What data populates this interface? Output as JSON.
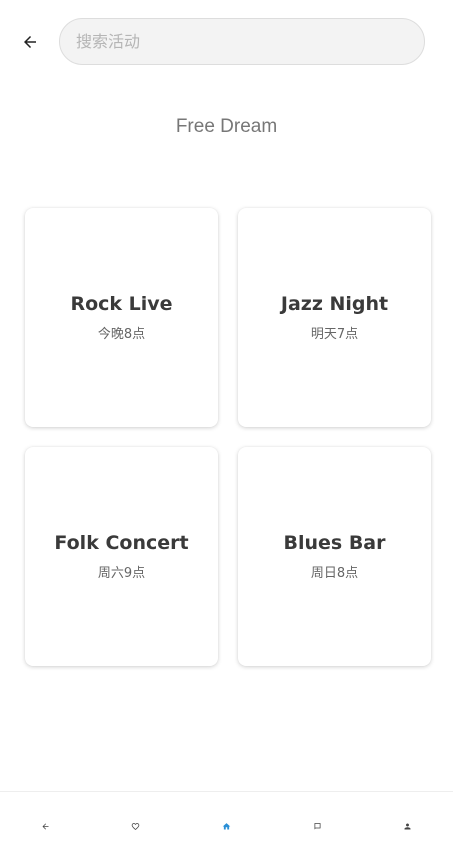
{
  "header": {
    "back_icon": "arrow-left-icon",
    "search": {
      "placeholder": "搜索活动",
      "value": ""
    }
  },
  "page_title": "Free Dream",
  "events": [
    {
      "title": "Rock Live",
      "time": "今晚8点"
    },
    {
      "title": "Jazz Night",
      "time": "明天7点"
    },
    {
      "title": "Folk Concert",
      "time": "周六9点"
    },
    {
      "title": "Blues Bar",
      "time": "周日8点"
    }
  ],
  "bottom_nav": {
    "items": [
      {
        "icon": "back-arrow-icon",
        "active": false
      },
      {
        "icon": "heart-icon",
        "active": false
      },
      {
        "icon": "home-icon",
        "active": true
      },
      {
        "icon": "book-icon",
        "active": false
      },
      {
        "icon": "person-icon",
        "active": false
      }
    ]
  },
  "colors": {
    "accent": "#2a8fd6",
    "nav_inactive": "#444444",
    "title_gray": "#777777",
    "card_title": "#3a3a3a"
  }
}
